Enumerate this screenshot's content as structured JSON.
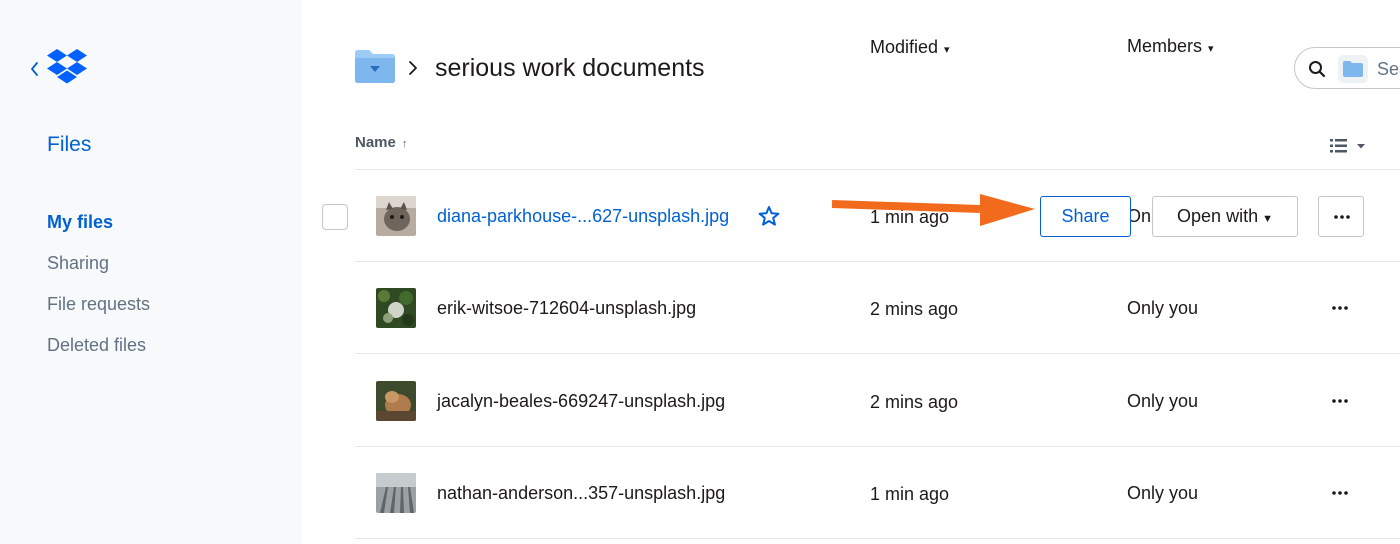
{
  "sidebar": {
    "title": "Files",
    "nav": [
      {
        "label": "My files",
        "active": true
      },
      {
        "label": "Sharing",
        "active": false
      },
      {
        "label": "File requests",
        "active": false
      },
      {
        "label": "Deleted files",
        "active": false
      }
    ]
  },
  "header": {
    "title": "serious work documents",
    "search_placeholder": "Search"
  },
  "columns": {
    "name": "Name",
    "modified": "Modified",
    "members": "Members"
  },
  "files": [
    {
      "name": "diana-parkhouse-...627-unsplash.jpg",
      "modified": "1 min ago",
      "members": "Only you",
      "starred": false
    },
    {
      "name": "erik-witsoe-712604-unsplash.jpg",
      "modified": "2 mins ago",
      "members": "Only you"
    },
    {
      "name": "jacalyn-beales-669247-unsplash.jpg",
      "modified": "2 mins ago",
      "members": "Only you"
    },
    {
      "name": "nathan-anderson...357-unsplash.jpg",
      "modified": "1 min ago",
      "members": "Only you"
    }
  ],
  "row_actions": {
    "share_label": "Share",
    "open_with_label": "Open with"
  },
  "colors": {
    "accent": "#0061d5",
    "sidebar_bg": "#f7f9fa",
    "annotation_arrow": "#f26b1d",
    "muted_text": "#637282"
  },
  "icons": [
    "back-chevron-icon",
    "dropbox-logo-icon",
    "folder-icon",
    "chevron-right-icon",
    "search-icon",
    "star-outline-icon",
    "more-dots-icon",
    "list-view-icon",
    "sort-arrow-up-icon",
    "caret-down-icon"
  ]
}
